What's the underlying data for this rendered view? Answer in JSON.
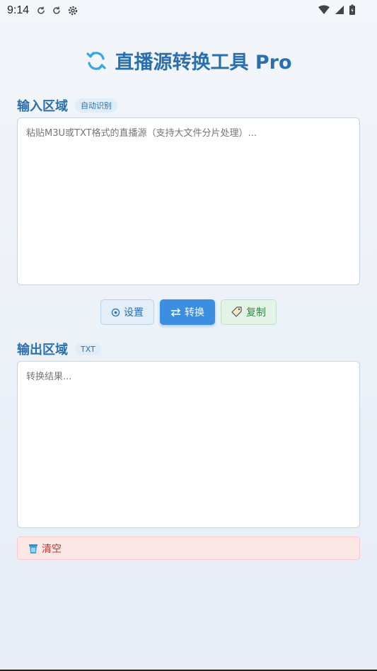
{
  "status_bar": {
    "time": "9:14",
    "left_icons": [
      "sync-icon",
      "sync-icon",
      "gear-icon"
    ],
    "right_icons": [
      "wifi-icon",
      "signal-icon",
      "battery-icon"
    ]
  },
  "app": {
    "title": "直播源转换工具 Pro",
    "title_icon": "refresh-icon",
    "accent": "#2a6fb0"
  },
  "input_section": {
    "title": "输入区域",
    "badge": "自动识别",
    "placeholder": "粘贴M3U或TXT格式的直播源（支持大文件分片处理）...",
    "value": ""
  },
  "buttons": {
    "settings": {
      "label": "设置",
      "icon": "gear-icon"
    },
    "convert": {
      "label": "转换",
      "icon": "swap-icon"
    },
    "copy": {
      "label": "复制",
      "icon": "tag-icon"
    }
  },
  "output_section": {
    "title": "输出区域",
    "badge": "TXT",
    "placeholder": "转换结果...",
    "value": ""
  },
  "clear": {
    "label": "清空",
    "icon": "trash-icon"
  }
}
